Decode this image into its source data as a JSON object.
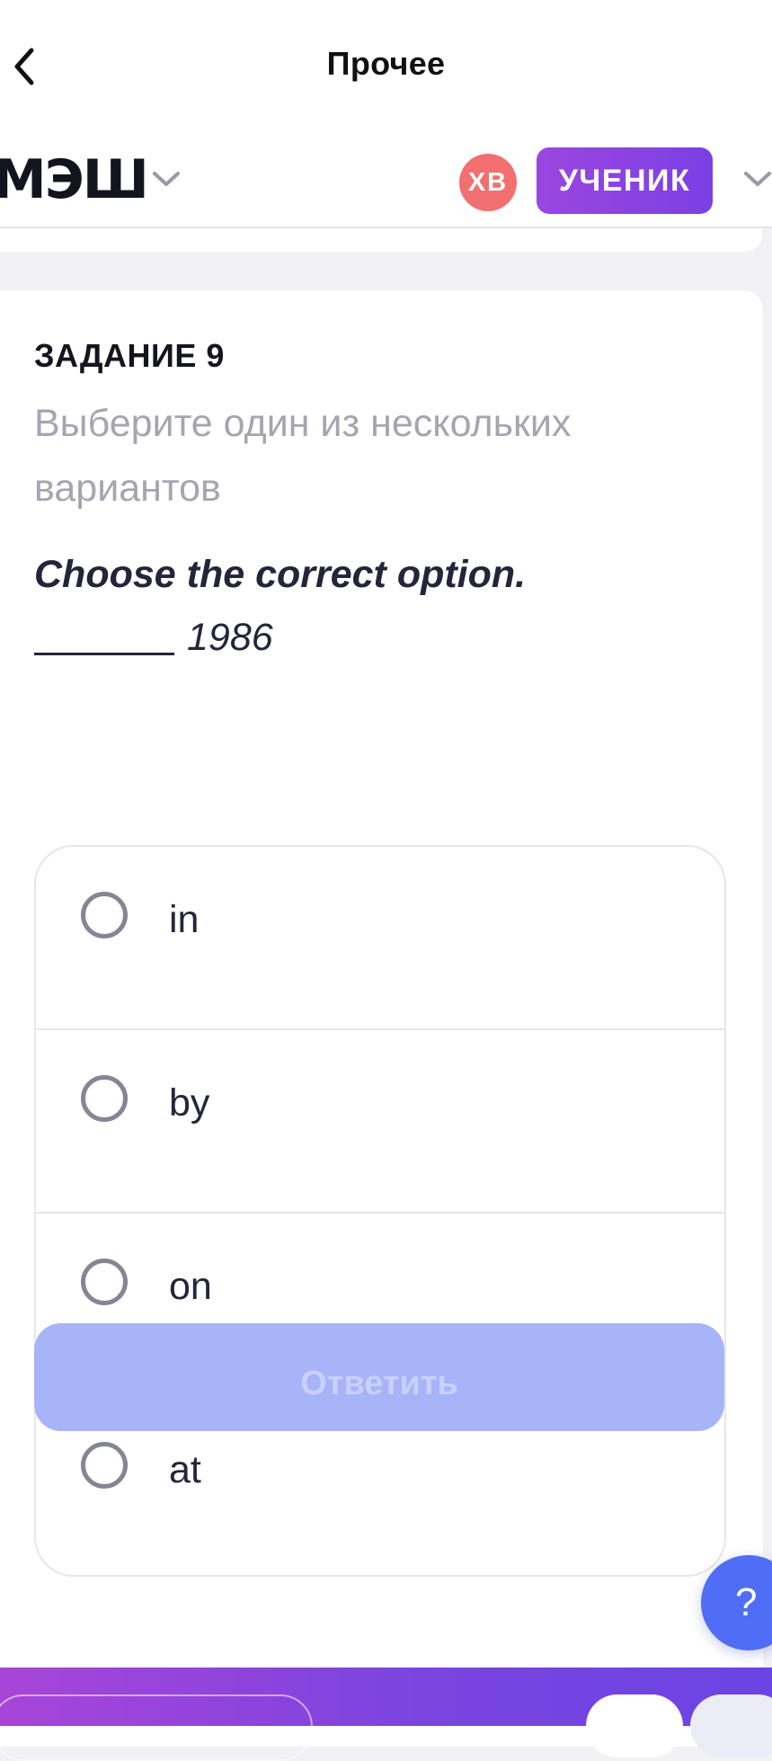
{
  "topbar": {
    "title": "Прочее",
    "back_icon": "chevron-left-icon"
  },
  "appbar": {
    "logo": "МЭШ",
    "logo_menu_icon": "chevron-down-icon",
    "avatar_initials": "ХВ",
    "role_label": "УЧЕНИК",
    "role_menu_icon": "chevron-down-icon",
    "colors": {
      "avatar": "#f27070",
      "role_badge": "#8e43e2"
    }
  },
  "task": {
    "number_label": "ЗАДАНИЕ 9",
    "instruction": "Выберите один из нескольких вариантов",
    "question": "Choose the correct option.",
    "gap_text": "1986",
    "options": [
      {
        "label": "in",
        "selected": false
      },
      {
        "label": "by",
        "selected": false
      },
      {
        "label": "on",
        "selected": false
      },
      {
        "label": "at",
        "selected": false
      }
    ],
    "submit_label": "Ответить"
  },
  "help_fab": {
    "label": "?",
    "icon": "question-icon",
    "color": "#4f6ef5"
  }
}
